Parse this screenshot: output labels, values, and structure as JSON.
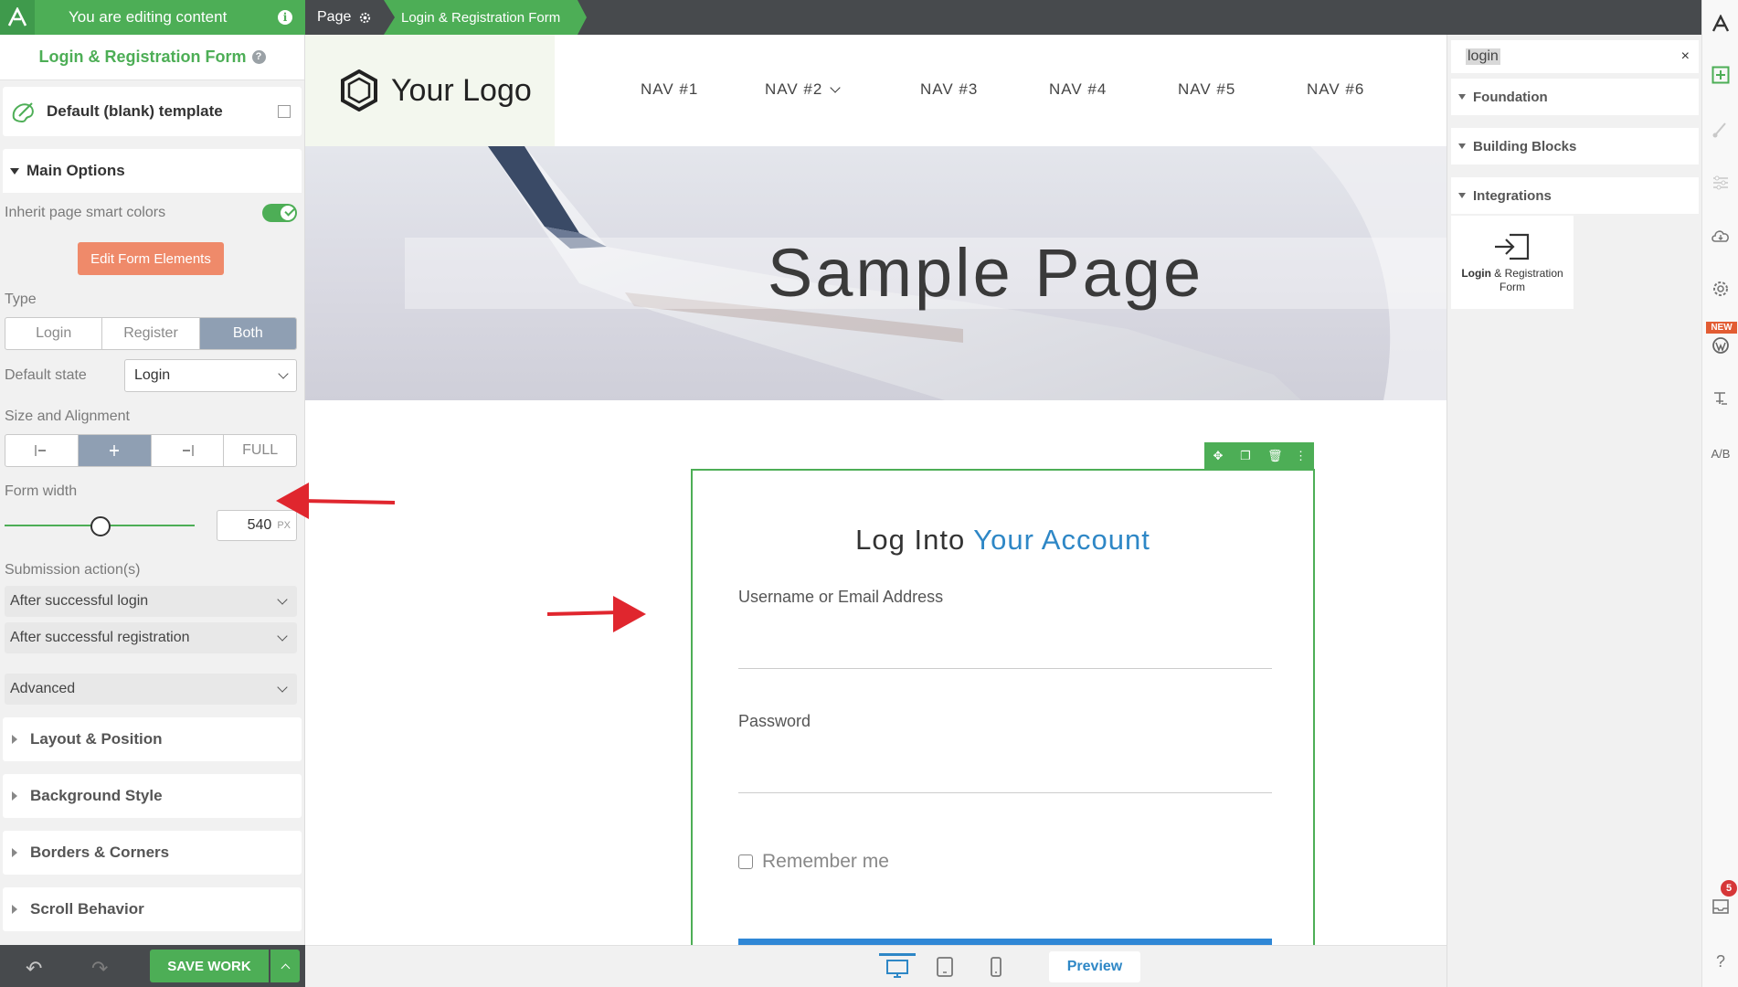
{
  "topbar": {
    "editing_label": "You are editing content",
    "page_label": "Page",
    "crumb_label": "Login & Registration Form"
  },
  "left_panel": {
    "title": "Login & Registration Form",
    "template_label": "Default (blank) template",
    "main_options": {
      "heading": "Main Options",
      "inherit_colors_label": "Inherit page smart colors",
      "inherit_colors_on": true,
      "edit_form_button": "Edit Form Elements",
      "type_label": "Type",
      "type_options": [
        "Login",
        "Register",
        "Both"
      ],
      "type_selected": "Both",
      "default_state_label": "Default state",
      "default_state_value": "Login",
      "size_alignment_label": "Size and Alignment",
      "full_label": "FULL",
      "form_width_label": "Form width",
      "form_width_value": "540",
      "form_width_unit": "PX",
      "submission_label": "Submission action(s)",
      "after_login_label": "After successful login",
      "after_registration_label": "After successful registration",
      "advanced_label": "Advanced"
    },
    "sections": [
      "Layout & Position",
      "Background Style",
      "Borders & Corners",
      "Scroll Behavior"
    ],
    "save_label": "SAVE WORK"
  },
  "canvas": {
    "logo_text": "Your Logo",
    "nav": [
      "NAV #1",
      "NAV #2",
      "NAV #3",
      "NAV #4",
      "NAV #5",
      "NAV #6"
    ],
    "hero_title": "Sample Page",
    "form": {
      "heading_plain": "Log Into ",
      "heading_accent": "Your Account",
      "username_label": "Username or Email Address",
      "password_label": "Password",
      "remember_label": "Remember me"
    },
    "preview_label": "Preview"
  },
  "right_panel": {
    "search_value": "login",
    "categories": [
      "Foundation",
      "Building Blocks",
      "Integrations"
    ],
    "element_bold": "Login",
    "element_rest": " & Registration Form"
  },
  "rail": {
    "new_badge": "NEW",
    "ab_label": "A/B",
    "notification_count": "5"
  },
  "colors": {
    "accent_green": "#4dae56",
    "accent_blue": "#2e87c6",
    "edit_button": "#ef8a6a",
    "dark_bar": "#474a4d"
  }
}
